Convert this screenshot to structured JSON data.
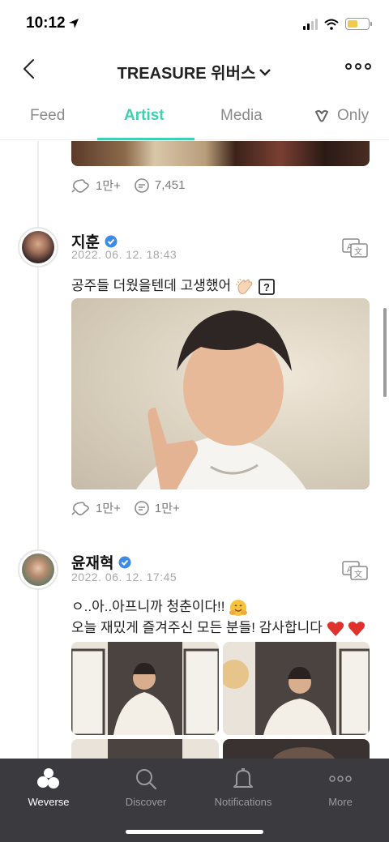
{
  "status": {
    "time": "10:12"
  },
  "nav": {
    "title": "TREASURE 위버스"
  },
  "tabs": [
    {
      "label": "Feed"
    },
    {
      "label": "Artist"
    },
    {
      "label": "Media"
    },
    {
      "label": "Only"
    }
  ],
  "posts": [
    {
      "likes": "1만+",
      "comments": "7,451"
    },
    {
      "author": "지훈",
      "date": "2022. 06. 12. 18:43",
      "text": "공주들 더웠을텐데 고생했어",
      "likes": "1만+",
      "comments": "1만+"
    },
    {
      "author": "윤재혁",
      "date": "2022. 06. 12. 17:45",
      "text_line1": "ㅇ..아..아프니까 청춘이다!!",
      "text_line2": "오늘 재밌게 즐겨주신 모든 분들! 감사합니다"
    }
  ],
  "bottom_nav": [
    {
      "label": "Weverse",
      "icon": "weverse-icon"
    },
    {
      "label": "Discover",
      "icon": "search-icon"
    },
    {
      "label": "Notifications",
      "icon": "bell-icon"
    },
    {
      "label": "More",
      "icon": "more-dots-icon"
    }
  ],
  "colors": {
    "accent": "#3ed0b0",
    "verified": "#3d8be8",
    "tabbar": "#3b3b3f"
  }
}
